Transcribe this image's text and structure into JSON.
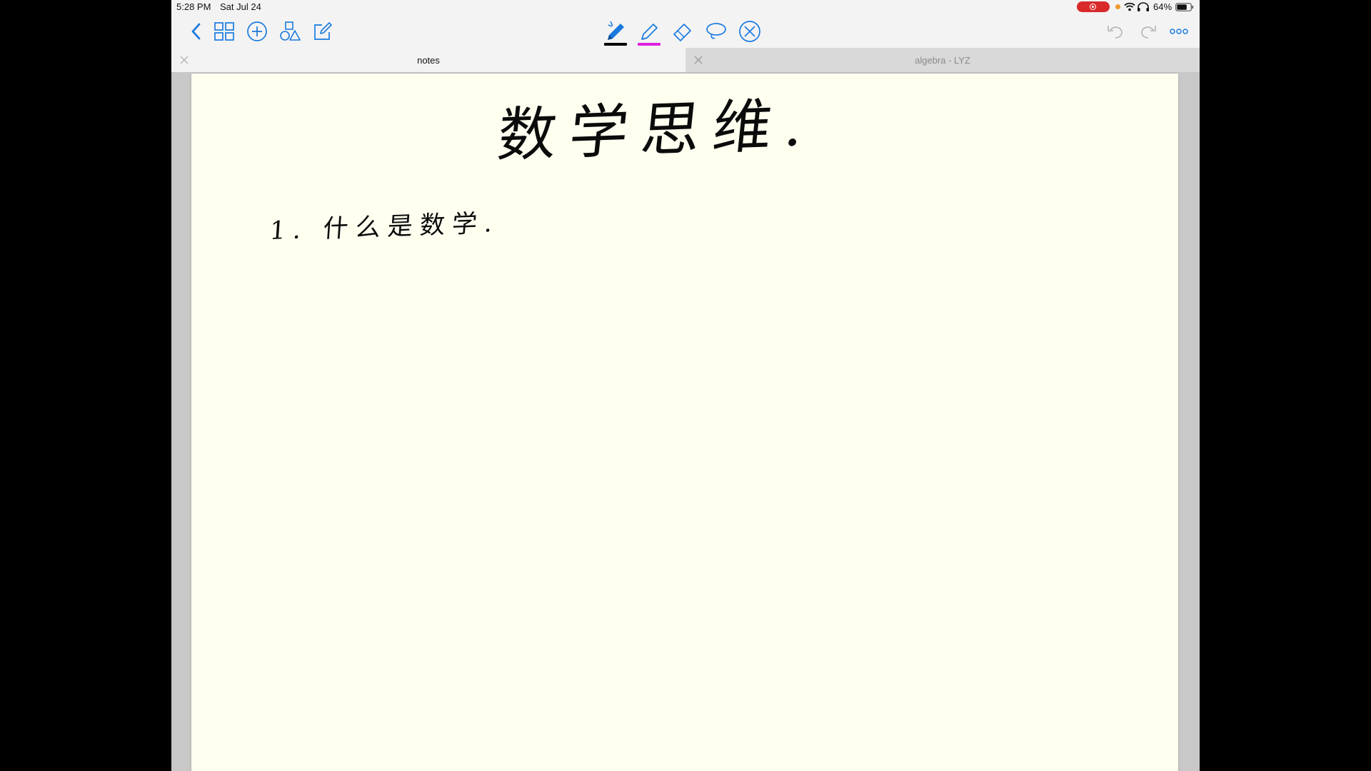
{
  "status_bar": {
    "time": "5:28 PM",
    "date": "Sat Jul 24",
    "battery": "64%",
    "icons": [
      "screen-record-icon",
      "microphone-indicator-icon",
      "wifi-icon",
      "headphones-icon",
      "battery-icon"
    ],
    "record_color": "#d9292b",
    "mic_indicator_color": "#f09a2c"
  },
  "toolbar": {
    "left_tools": [
      "back-icon",
      "thumbnails-grid-icon",
      "add-icon",
      "shapes-icon",
      "edit-icon"
    ],
    "center_tools": [
      "pen-icon",
      "highlighter-icon",
      "eraser-icon",
      "lasso-icon",
      "disable-touch-icon"
    ],
    "right_tools": [
      "undo-icon",
      "redo-icon",
      "more-icon"
    ],
    "accent": "#1a7ae0",
    "pen_color": "#000000",
    "highlighter_color": "#e020e0"
  },
  "tabs": [
    {
      "label": "notes",
      "active": true
    },
    {
      "label": "algebra - LYZ",
      "active": false
    }
  ],
  "page": {
    "background": "#fffff0",
    "handwriting": {
      "title": "数学思维.",
      "line1": "1. 什么是数学."
    }
  }
}
